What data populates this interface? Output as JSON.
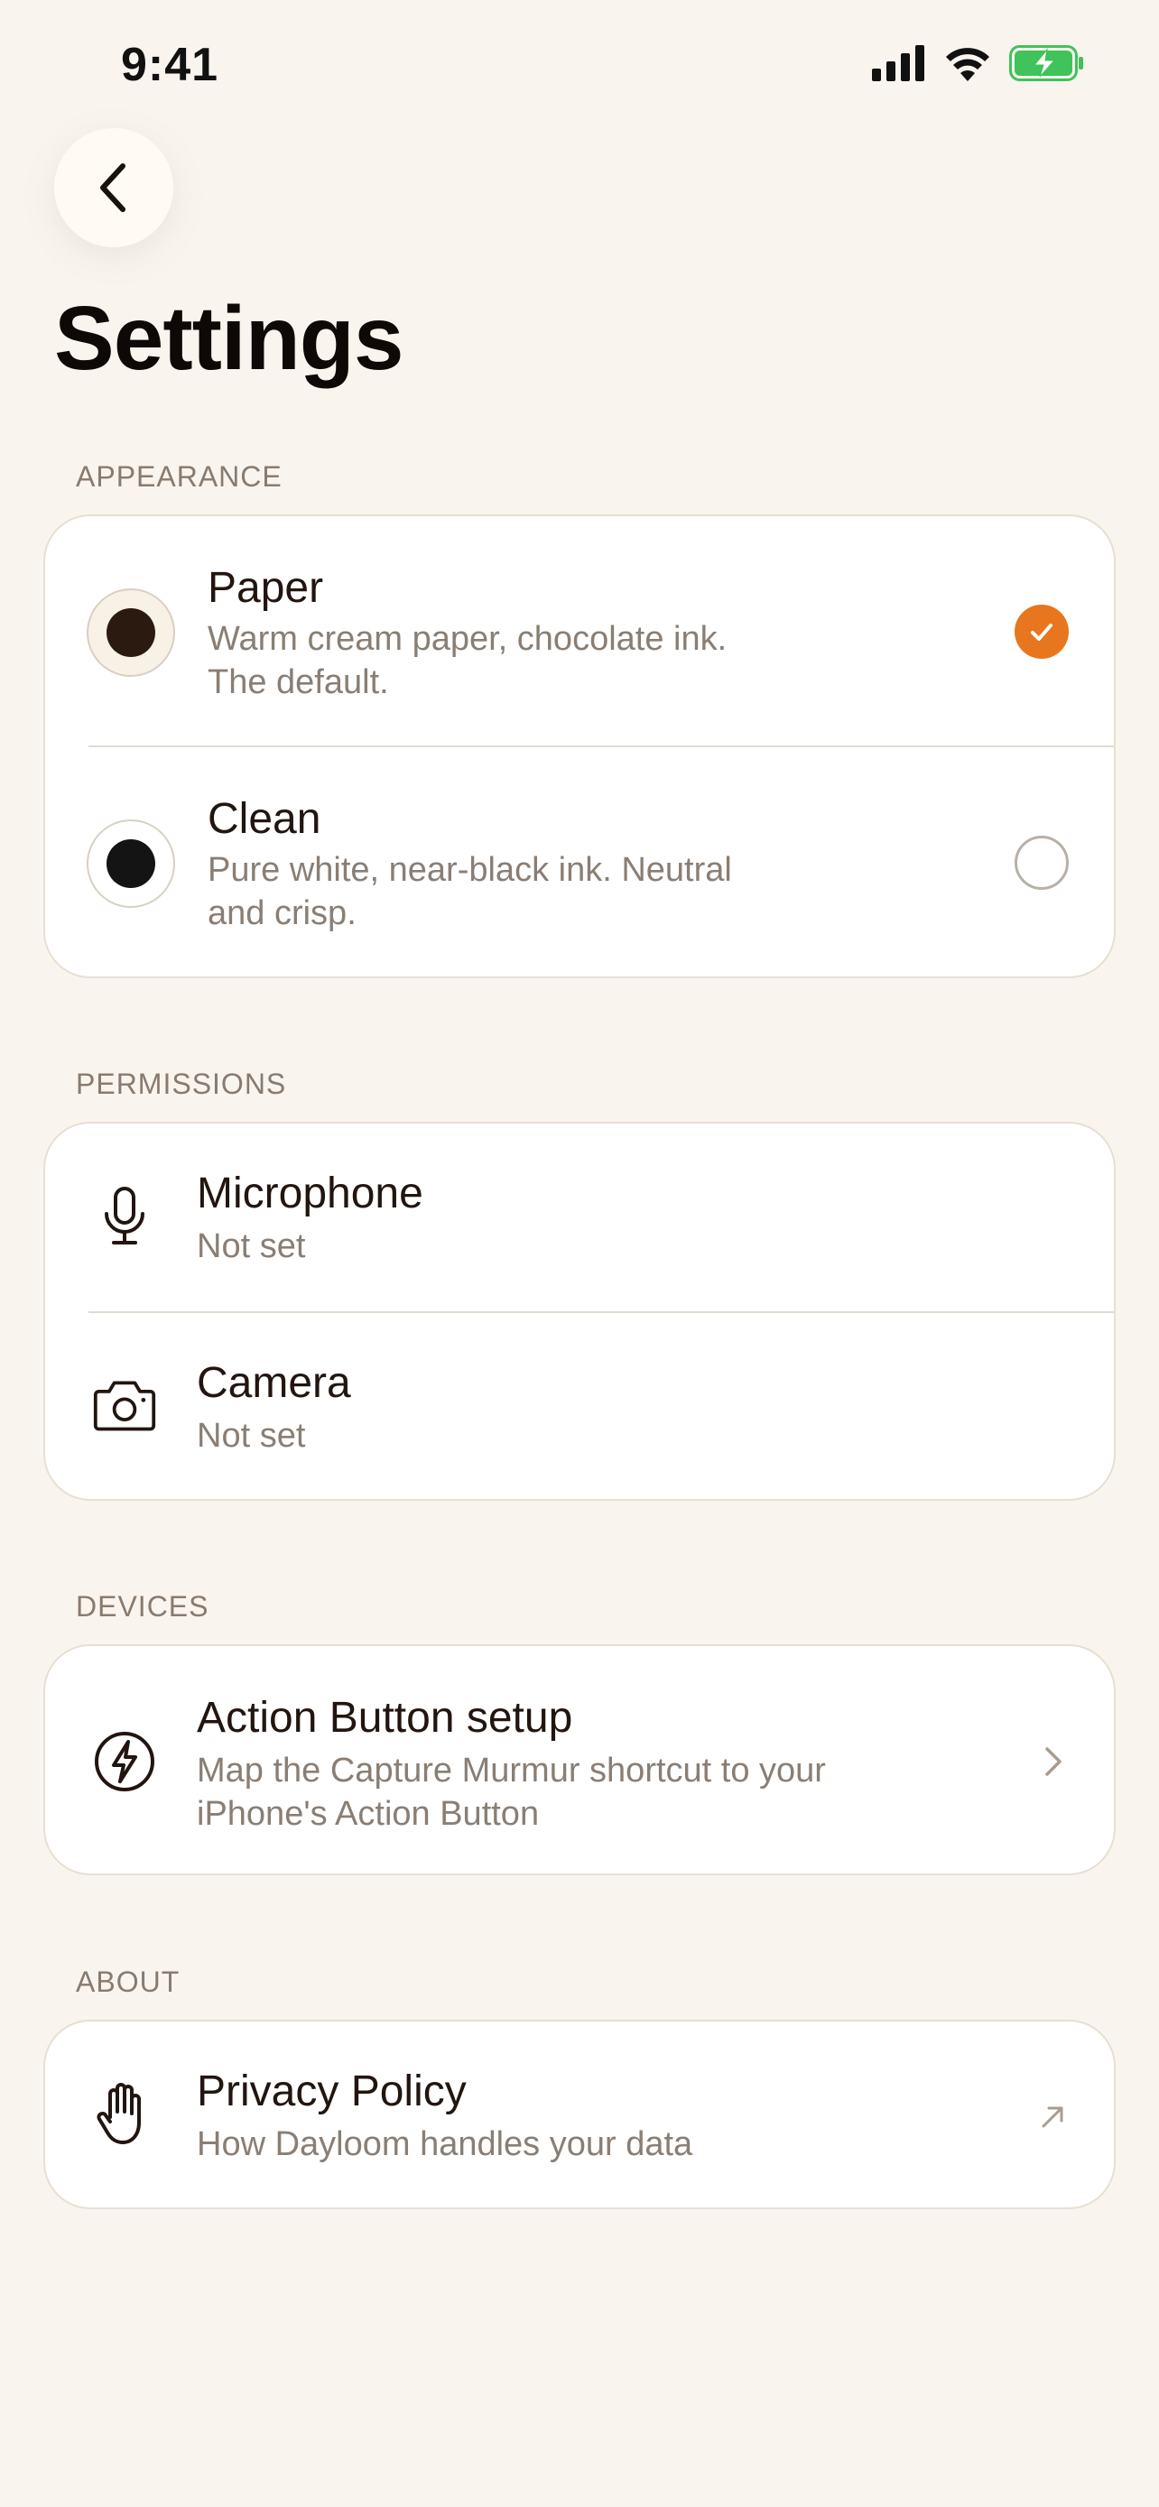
{
  "status_bar": {
    "time": "9:41"
  },
  "page": {
    "title": "Settings"
  },
  "appearance": {
    "header": "APPEARANCE",
    "options": [
      {
        "title": "Paper",
        "desc_line1": "Warm cream paper, chocolate ink.",
        "desc_line2": "The default.",
        "selected": true,
        "swatch_bg": "#F7F1E6",
        "swatch_ink": "#2B1A10"
      },
      {
        "title": "Clean",
        "desc_line1": "Pure white, near-black ink. Neutral",
        "desc_line2": "and crisp.",
        "selected": false,
        "swatch_bg": "#FFFFFF",
        "swatch_ink": "#141414"
      }
    ]
  },
  "permissions": {
    "header": "PERMISSIONS",
    "items": [
      {
        "title": "Microphone",
        "status": "Not set",
        "icon": "microphone-icon"
      },
      {
        "title": "Camera",
        "status": "Not set",
        "icon": "camera-icon"
      }
    ]
  },
  "devices": {
    "header": "DEVICES",
    "items": [
      {
        "title": "Action Button setup",
        "desc_line1": "Map the Capture Murmur shortcut to your",
        "desc_line2": "iPhone's Action Button",
        "icon": "bolt-icon"
      }
    ]
  },
  "about": {
    "header": "ABOUT",
    "items": [
      {
        "title": "Privacy Policy",
        "desc": "How Dayloom handles your data",
        "icon": "hand-icon"
      }
    ]
  },
  "colors": {
    "accent": "#E8761E",
    "background": "#F9F5EE",
    "battery": "#3FC35A"
  }
}
